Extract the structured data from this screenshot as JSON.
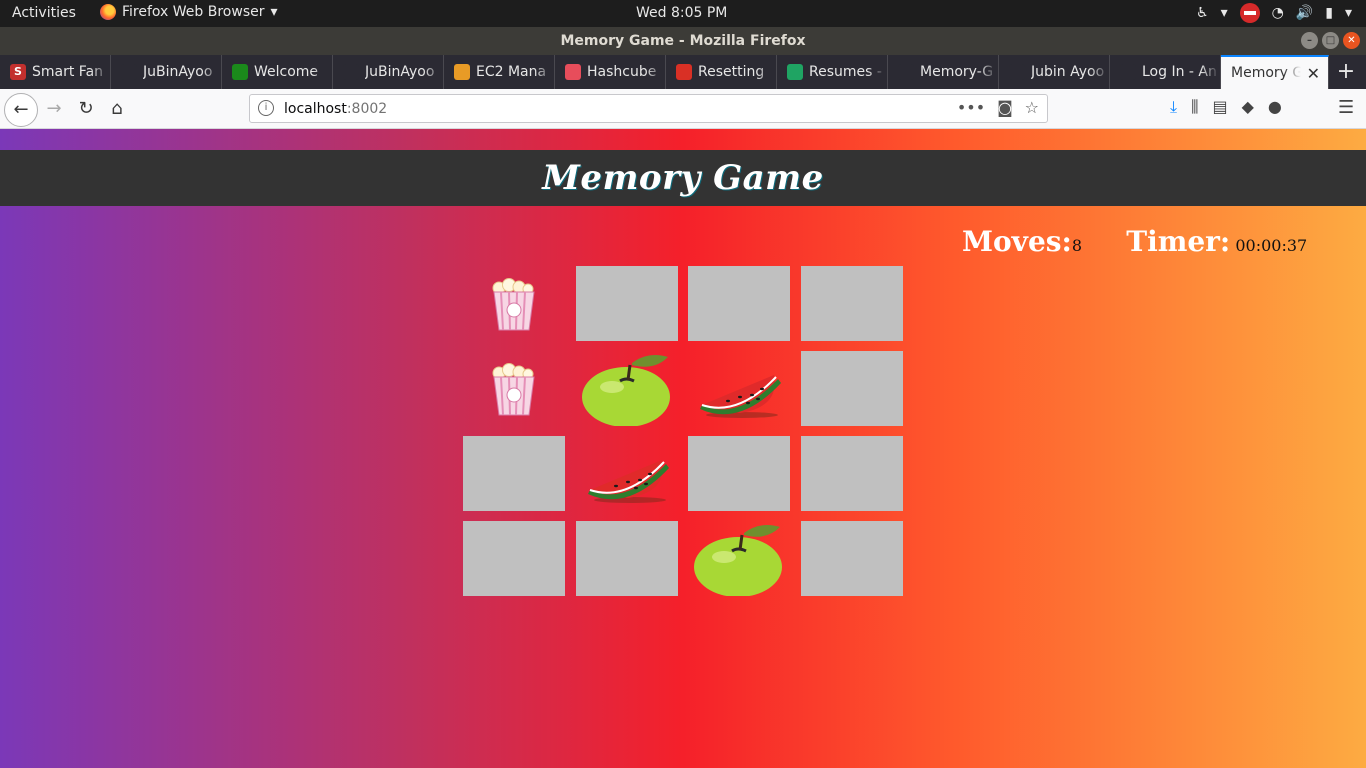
{
  "os_bar": {
    "activities": "Activities",
    "app_name": "Firefox Web Browser",
    "clock": "Wed  8:05 PM"
  },
  "window": {
    "title": "Memory Game - Mozilla Firefox"
  },
  "tabs": [
    {
      "label": "Smart Fan",
      "favicon": "S",
      "color": "#c3302e"
    },
    {
      "label": "JuBinAyoo",
      "favicon": "github-icon",
      "color": "#2b2a33"
    },
    {
      "label": "Welcome",
      "favicon": "a-icon",
      "color": "#1b8a1b"
    },
    {
      "label": "JuBinAyoo",
      "favicon": "github-icon",
      "color": "#2b2a33"
    },
    {
      "label": "EC2 Mana",
      "favicon": "box-icon",
      "color": "#e89b26"
    },
    {
      "label": "Hashcube",
      "favicon": "hashcube-icon",
      "color": "#e74d5b"
    },
    {
      "label": "Resetting",
      "favicon": "gmail-icon",
      "color": "#d93025"
    },
    {
      "label": "Resumes -",
      "favicon": "drive-icon",
      "color": "#1fa463"
    },
    {
      "label": "Memory-G",
      "favicon": "github-icon",
      "color": "#2b2a33"
    },
    {
      "label": "Jubin Ayoo",
      "favicon": "peace-icon",
      "color": "#2b2a33"
    },
    {
      "label": "Log In - An",
      "favicon": "peace-icon",
      "color": "#2b2a33"
    }
  ],
  "active_tab": {
    "label": "Memory Ga"
  },
  "url": {
    "host": "localhost",
    "port": ":8002"
  },
  "game": {
    "title": "Memory Game",
    "moves_label": "Moves:",
    "moves_value": "8",
    "timer_label": "Timer:",
    "timer_value": "00:00:37",
    "cards": [
      {
        "state": "open",
        "icon": "popcorn"
      },
      {
        "state": "closed"
      },
      {
        "state": "closed"
      },
      {
        "state": "closed"
      },
      {
        "state": "open",
        "icon": "popcorn"
      },
      {
        "state": "open",
        "icon": "apple"
      },
      {
        "state": "open",
        "icon": "watermelon"
      },
      {
        "state": "closed"
      },
      {
        "state": "closed"
      },
      {
        "state": "open",
        "icon": "watermelon"
      },
      {
        "state": "closed"
      },
      {
        "state": "closed"
      },
      {
        "state": "closed"
      },
      {
        "state": "closed"
      },
      {
        "state": "open",
        "icon": "apple"
      },
      {
        "state": "closed"
      }
    ]
  }
}
